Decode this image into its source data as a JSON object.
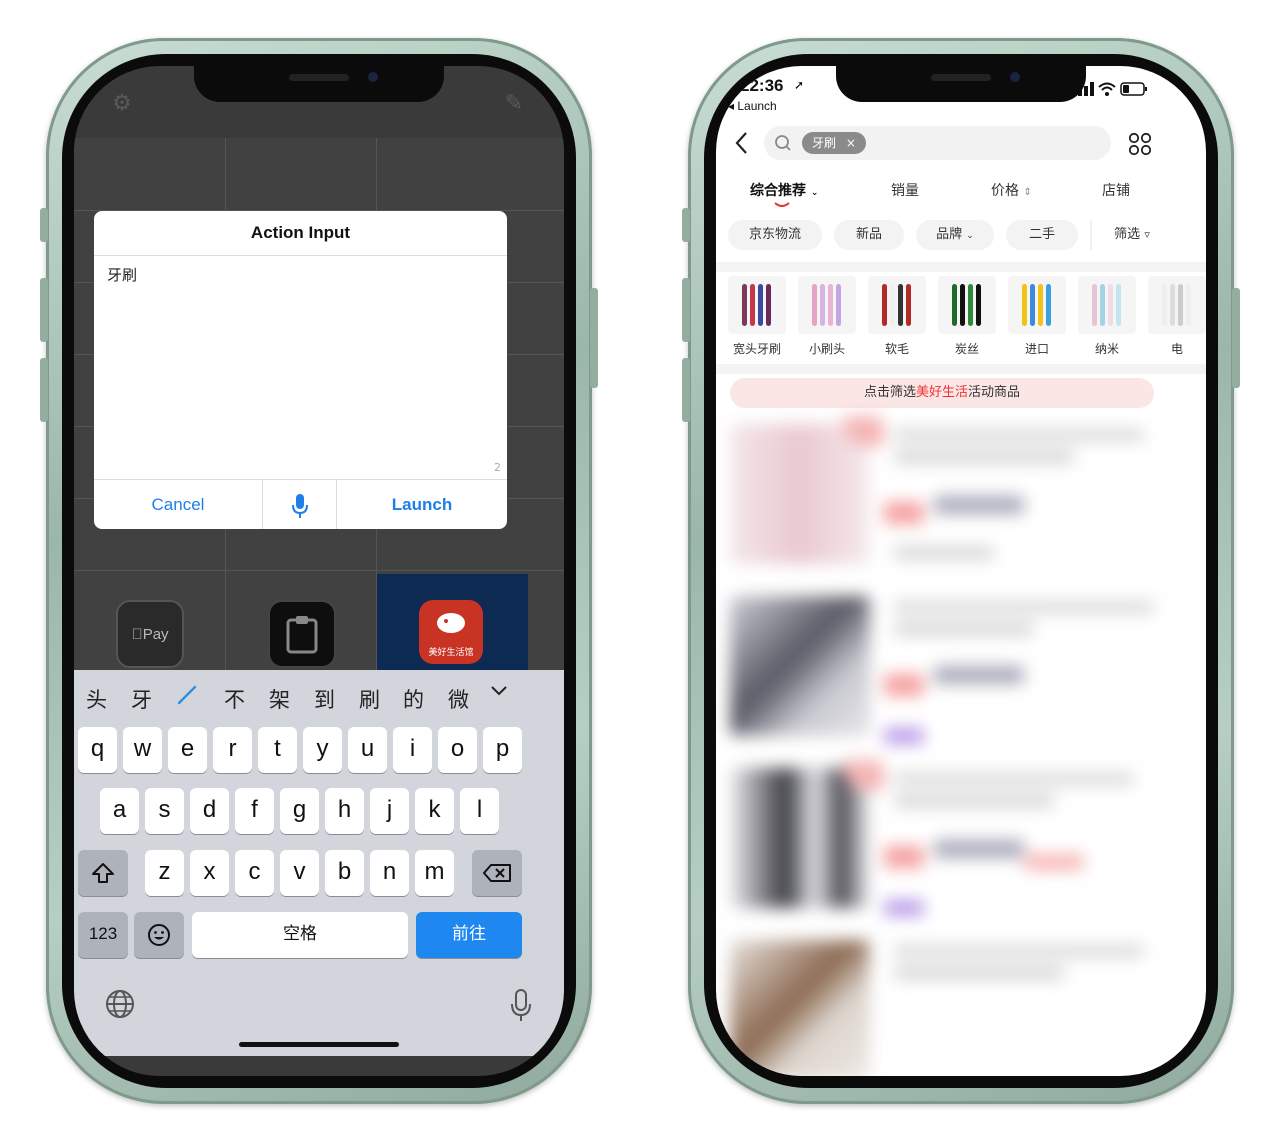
{
  "left_phone": {
    "app_icons": [
      {
        "name": "apple-pay",
        "label": "Pay"
      },
      {
        "name": "clipboard",
        "label": ""
      },
      {
        "name": "jd-mascot",
        "label": "美好生活馆"
      }
    ],
    "dialog": {
      "title": "Action Input",
      "text_value": "牙刷",
      "char_count": "2",
      "cancel_label": "Cancel",
      "launch_label": "Launch"
    },
    "keyboard": {
      "candidates": [
        "头",
        "牙",
        "/",
        "不",
        "架",
        "到",
        "刷",
        "的",
        "微"
      ],
      "row1": [
        "q",
        "w",
        "e",
        "r",
        "t",
        "y",
        "u",
        "i",
        "o",
        "p"
      ],
      "row2": [
        "a",
        "s",
        "d",
        "f",
        "g",
        "h",
        "j",
        "k",
        "l"
      ],
      "row3": [
        "z",
        "x",
        "c",
        "v",
        "b",
        "n",
        "m"
      ],
      "num_label": "123",
      "space_label": "空格",
      "go_label": "前往",
      "go_color": "#1e88f0"
    }
  },
  "right_phone": {
    "status": {
      "time": "22:36",
      "back_label": "◂ Launch"
    },
    "search": {
      "chip": "牙刷"
    },
    "sorts": [
      "综合推荐",
      "销量",
      "价格",
      "店铺"
    ],
    "filters": [
      "京东物流",
      "新品",
      "品牌",
      "二手",
      "筛选"
    ],
    "categories": [
      "宽头牙刷",
      "小刷头",
      "软毛",
      "炭丝",
      "进口",
      "纳米",
      "电"
    ],
    "banner": {
      "prefix": "点击筛选",
      "highlight": "美好生活",
      "suffix": "活动商品"
    },
    "accent_color": "#e33333"
  }
}
